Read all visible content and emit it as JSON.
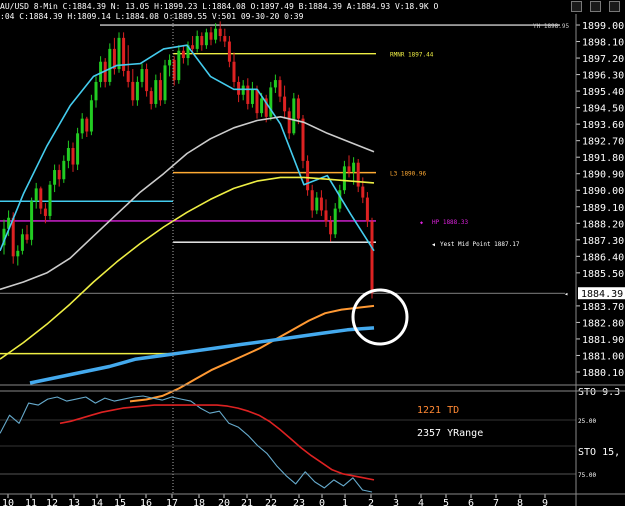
{
  "header": {
    "info": "AU/USD 8-Min C:1884.39 N: 13.05 H:1899.23 L:1884.08 O:1897.49 B:1884.39 A:1884.93 V:18.9K O",
    "info2": ":04 C:1884.39 H:1809.14 L:1884.08 O:1889.55 V:501 09-30-20 0:39"
  },
  "window_controls": [
    "minimize-icon",
    "restore-icon",
    "close-icon"
  ],
  "colors": {
    "background": "#000000",
    "bull_candle": "#22cc22",
    "bear_candle": "#dd2222",
    "fast_ma": "#44ccee",
    "mid_ma": "#cccccc",
    "slow_ma": "#eeee44",
    "orange_ma": "#ff9933",
    "blue_ma": "#44aaee",
    "hline_yellow": "#eeee44",
    "hline_cyan": "#44ccee",
    "hline_magenta": "#dd22dd",
    "hline_white": "#ffffff",
    "hline_orange": "#ffaa33",
    "stoch_cyan": "#66aacc",
    "stoch_red": "#dd2222",
    "td_orange": "#ff8833",
    "circle": "#ffffff"
  },
  "chart_data": [
    {
      "type": "candlestick",
      "title": "",
      "ylim": [
        1879.5,
        1899.6
      ],
      "y_ticks": [
        "1899.00",
        "1898.10",
        "1897.20",
        "1896.30",
        "1895.40",
        "1894.50",
        "1893.60",
        "1892.70",
        "1891.80",
        "1890.90",
        "1890.00",
        "1889.10",
        "1888.20",
        "1887.30",
        "1886.40",
        "1885.50",
        "1883.70",
        "1882.80",
        "1881.90",
        "1881.00",
        "1880.10"
      ],
      "last_price_label": "1884.39",
      "x_ticks": [
        "10",
        "11",
        "12",
        "13",
        "14",
        "15",
        "16",
        "17",
        "18",
        "20",
        "21",
        "22",
        "23",
        "0",
        "1",
        "2",
        "3",
        "4",
        "5",
        "6",
        "7",
        "8",
        "9"
      ],
      "bars": [
        [
          1887.0,
          1888.4,
          1886.5,
          1887.9
        ],
        [
          1887.9,
          1888.9,
          1887.5,
          1888.5
        ],
        [
          1888.5,
          1888.8,
          1886.0,
          1886.4
        ],
        [
          1886.4,
          1887.0,
          1885.9,
          1886.7
        ],
        [
          1886.7,
          1887.9,
          1886.5,
          1887.6
        ],
        [
          1887.6,
          1888.1,
          1887.1,
          1887.3
        ],
        [
          1887.3,
          1889.6,
          1887.0,
          1889.4
        ],
        [
          1889.4,
          1890.4,
          1889.0,
          1890.1
        ],
        [
          1890.1,
          1890.2,
          1888.7,
          1889.0
        ],
        [
          1889.0,
          1889.3,
          1888.2,
          1888.6
        ],
        [
          1888.6,
          1890.5,
          1888.4,
          1890.3
        ],
        [
          1890.3,
          1891.4,
          1889.9,
          1891.1
        ],
        [
          1891.1,
          1891.4,
          1890.2,
          1890.6
        ],
        [
          1890.6,
          1891.9,
          1890.4,
          1891.6
        ],
        [
          1891.6,
          1892.7,
          1891.2,
          1892.3
        ],
        [
          1892.3,
          1892.6,
          1891.0,
          1891.4
        ],
        [
          1891.4,
          1893.4,
          1891.1,
          1893.1
        ],
        [
          1893.1,
          1894.2,
          1892.8,
          1893.9
        ],
        [
          1893.9,
          1894.0,
          1892.9,
          1893.2
        ],
        [
          1893.2,
          1895.2,
          1893.0,
          1894.9
        ],
        [
          1894.9,
          1896.2,
          1894.5,
          1895.9
        ],
        [
          1895.9,
          1897.3,
          1895.6,
          1897.0
        ],
        [
          1897.0,
          1897.2,
          1895.6,
          1895.9
        ],
        [
          1895.9,
          1898.0,
          1895.7,
          1897.7
        ],
        [
          1897.7,
          1898.3,
          1896.3,
          1896.6
        ],
        [
          1896.6,
          1898.6,
          1896.4,
          1898.3
        ],
        [
          1898.3,
          1898.6,
          1896.2,
          1896.5
        ],
        [
          1896.5,
          1897.9,
          1895.6,
          1895.9
        ],
        [
          1895.9,
          1896.6,
          1894.6,
          1894.9
        ],
        [
          1894.9,
          1896.2,
          1894.6,
          1895.9
        ],
        [
          1895.9,
          1896.9,
          1895.6,
          1896.6
        ],
        [
          1896.6,
          1896.9,
          1895.1,
          1895.4
        ],
        [
          1895.4,
          1895.6,
          1894.4,
          1894.7
        ],
        [
          1894.7,
          1896.3,
          1894.5,
          1896.0
        ],
        [
          1896.0,
          1896.4,
          1894.6,
          1894.9
        ],
        [
          1894.9,
          1897.1,
          1894.7,
          1896.8
        ],
        [
          1896.8,
          1897.4,
          1896.2,
          1897.1
        ],
        [
          1897.1,
          1897.3,
          1895.7,
          1896.0
        ],
        [
          1896.0,
          1897.9,
          1895.8,
          1897.6
        ],
        [
          1897.6,
          1897.9,
          1896.9,
          1897.2
        ],
        [
          1897.2,
          1898.1,
          1896.8,
          1897.9
        ],
        [
          1897.9,
          1898.4,
          1897.4,
          1897.7
        ],
        [
          1897.7,
          1898.7,
          1897.5,
          1898.4
        ],
        [
          1898.4,
          1898.6,
          1897.6,
          1897.9
        ],
        [
          1897.9,
          1898.8,
          1897.7,
          1898.6
        ],
        [
          1898.6,
          1898.9,
          1897.9,
          1898.2
        ],
        [
          1898.2,
          1899.1,
          1898.0,
          1898.8
        ],
        [
          1898.8,
          1899.2,
          1898.1,
          1898.4
        ],
        [
          1898.4,
          1898.8,
          1897.8,
          1898.1
        ],
        [
          1898.1,
          1898.4,
          1896.7,
          1897.0
        ],
        [
          1897.0,
          1897.5,
          1895.6,
          1895.9
        ],
        [
          1895.9,
          1896.2,
          1894.8,
          1895.2
        ],
        [
          1895.2,
          1896.0,
          1894.9,
          1895.7
        ],
        [
          1895.7,
          1896.1,
          1894.4,
          1894.7
        ],
        [
          1894.7,
          1895.9,
          1894.5,
          1895.5
        ],
        [
          1895.5,
          1895.7,
          1893.9,
          1894.2
        ],
        [
          1894.2,
          1895.3,
          1894.0,
          1895.0
        ],
        [
          1895.0,
          1895.2,
          1893.7,
          1894.0
        ],
        [
          1894.0,
          1895.9,
          1893.8,
          1895.6
        ],
        [
          1895.6,
          1896.3,
          1895.3,
          1896.0
        ],
        [
          1896.0,
          1896.2,
          1894.8,
          1895.1
        ],
        [
          1895.1,
          1895.7,
          1893.9,
          1894.3
        ],
        [
          1894.3,
          1894.5,
          1892.8,
          1893.1
        ],
        [
          1893.1,
          1895.3,
          1893.0,
          1895.0
        ],
        [
          1895.0,
          1895.2,
          1893.6,
          1893.9
        ],
        [
          1893.9,
          1894.1,
          1891.2,
          1891.6
        ],
        [
          1891.6,
          1891.9,
          1889.7,
          1890.0
        ],
        [
          1890.0,
          1890.3,
          1888.5,
          1888.9
        ],
        [
          1888.9,
          1889.9,
          1888.7,
          1889.6
        ],
        [
          1889.6,
          1890.0,
          1888.6,
          1888.9
        ],
        [
          1888.9,
          1889.5,
          1888.0,
          1888.3
        ],
        [
          1888.3,
          1888.6,
          1887.2,
          1887.6
        ],
        [
          1887.6,
          1889.3,
          1887.4,
          1889.0
        ],
        [
          1889.0,
          1890.3,
          1888.8,
          1890.0
        ],
        [
          1890.0,
          1891.6,
          1889.8,
          1891.3
        ],
        [
          1891.3,
          1891.9,
          1890.7,
          1891.0
        ],
        [
          1891.0,
          1891.8,
          1890.3,
          1891.5
        ],
        [
          1891.5,
          1891.7,
          1889.9,
          1890.2
        ],
        [
          1890.2,
          1890.7,
          1889.3,
          1889.6
        ],
        [
          1889.6,
          1889.9,
          1888.0,
          1888.3
        ],
        [
          1888.3,
          1888.5,
          1884.1,
          1884.4
        ]
      ],
      "moving_averages": [
        {
          "color": "fast_ma",
          "values": [
            1886.7,
            1889.8,
            1892.4,
            1894.6,
            1896.2,
            1896.8,
            1896.9,
            1897.7,
            1897.9,
            1896.2,
            1895.5,
            1895.5,
            1893.6,
            1890.3,
            1890.8,
            1888.7,
            1886.7
          ]
        },
        {
          "color": "mid_ma",
          "values": [
            1884.6,
            1885.0,
            1885.5,
            1886.3,
            1887.5,
            1888.7,
            1889.9,
            1890.9,
            1892.0,
            1892.8,
            1893.4,
            1893.8,
            1894.0,
            1893.7,
            1893.1,
            1892.6,
            1892.1
          ]
        },
        {
          "color": "slow_ma",
          "values": [
            1880.8,
            1881.7,
            1882.7,
            1883.8,
            1885.0,
            1886.1,
            1887.1,
            1888.0,
            1888.8,
            1889.5,
            1890.1,
            1890.5,
            1890.7,
            1890.7,
            1890.6,
            1890.5,
            1890.4
          ]
        },
        {
          "color": "orange_ma",
          "values": [
            1878.5,
            1878.6,
            1878.8,
            1879.2,
            1879.7,
            1880.2,
            1880.6,
            1881.0,
            1881.4,
            1881.9,
            1882.4,
            1882.9,
            1883.3,
            1883.5,
            1883.6,
            1883.7
          ]
        },
        {
          "color": "blue_ma",
          "values": [
            1879.5,
            1879.8,
            1880.1,
            1880.4,
            1880.8,
            1881.0,
            1881.2,
            1881.4,
            1881.6,
            1881.8,
            1882.0,
            1882.2,
            1882.4,
            1882.5
          ]
        }
      ],
      "levels": [
        {
          "price": 1899.0,
          "label": "YH 1898.95",
          "color": "mid_ma",
          "dash": false
        },
        {
          "price": 1897.44,
          "label": "RMNR 1897.44",
          "color": "hline_yellow",
          "dash": false
        },
        {
          "price": 1890.96,
          "label": "L3 1890.96",
          "color": "hline_orange",
          "dash": false
        },
        {
          "price": 1889.4,
          "label": "",
          "color": "hline_cyan",
          "dash": false
        },
        {
          "price": 1888.33,
          "label": "HP 1888.33",
          "color": "hline_magenta",
          "dash": false
        },
        {
          "price": 1887.17,
          "label": "Yest Mid Point 1887.17",
          "color": "hline_white",
          "dash": false
        },
        {
          "price": 1881.1,
          "label": "",
          "color": "hline_yellow",
          "dash": false
        },
        {
          "price": 1884.39,
          "label": "",
          "color": "mid_ma",
          "dash": false
        }
      ]
    },
    {
      "type": "line",
      "title": "",
      "indicator": "STO",
      "labels": [
        "STO 9.3",
        "STO 15,"
      ],
      "y_ticks": [
        "25.00",
        "75.00"
      ],
      "ylim": [
        0,
        100
      ],
      "series": [
        {
          "color": "stoch_cyan",
          "values": [
            60,
            78,
            70,
            90,
            88,
            94,
            96,
            92,
            94,
            96,
            90,
            95,
            92,
            94,
            96,
            97,
            95,
            93,
            96,
            94,
            92,
            85,
            80,
            82,
            70,
            66,
            58,
            48,
            40,
            28,
            18,
            10,
            22,
            12,
            6,
            14,
            8,
            16,
            4,
            2
          ]
        },
        {
          "color": "stoch_red",
          "values": [
            70,
            72,
            75,
            78,
            81,
            83,
            85,
            86,
            87,
            88,
            88,
            88,
            88,
            88,
            88,
            88,
            87,
            85,
            82,
            78,
            72,
            64,
            55,
            46,
            38,
            31,
            24,
            20,
            18,
            16,
            14
          ]
        }
      ],
      "annotations": [
        "1221 TD",
        "2357 YRange"
      ]
    }
  ]
}
